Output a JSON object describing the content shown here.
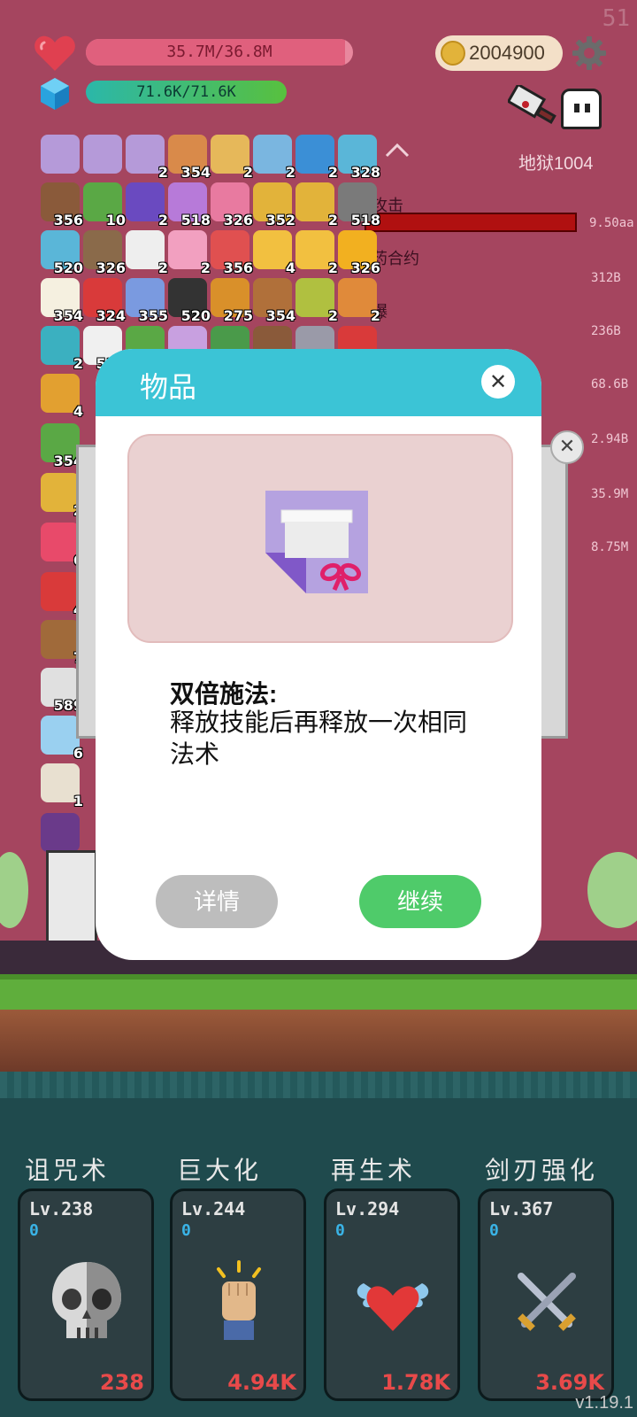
{
  "hud": {
    "fps": "51",
    "hp_text": "35.7M/36.8M",
    "hp_fraction": 0.97,
    "mp_text": "71.6K/71.6K",
    "mp_fraction": 1.0,
    "coins": "2004900",
    "level_name": "地狱1004"
  },
  "skills_list": [
    {
      "name": "攻击",
      "value": "9.50aa"
    },
    {
      "name": "药合约",
      "value": "312B"
    },
    {
      "name": "爆",
      "value": "236B"
    },
    {
      "name": "",
      "value": "68.6B"
    },
    {
      "name": "",
      "value": "2.94B"
    },
    {
      "name": "",
      "value": "35.9M"
    },
    {
      "name": "",
      "value": "8.75M"
    }
  ],
  "items": [
    {
      "icon": "box-icon",
      "count": "",
      "color": "#b59ad9"
    },
    {
      "icon": "box-icon",
      "count": "",
      "color": "#b59ad9"
    },
    {
      "icon": "box-icon",
      "count": "2",
      "color": "#b59ad9"
    },
    {
      "icon": "feather-icon",
      "count": "354",
      "color": "#d98a4a"
    },
    {
      "icon": "book-icon",
      "count": "2",
      "color": "#e6b85a"
    },
    {
      "icon": "molecule-icon",
      "count": "2",
      "color": "#7ab6e0"
    },
    {
      "icon": "star-card-icon",
      "count": "2",
      "color": "#3b8fd6"
    },
    {
      "icon": "pen-icon",
      "count": "328",
      "color": "#5ab6d8"
    },
    {
      "icon": "shield-icon",
      "count": "356",
      "color": "#8a5a3a"
    },
    {
      "icon": "card-icon",
      "count": "10",
      "color": "#5aa845"
    },
    {
      "icon": "wizard-hat-icon",
      "count": "2",
      "color": "#6a4ac0"
    },
    {
      "icon": "flower-icon",
      "count": "518",
      "color": "#b77ad9"
    },
    {
      "icon": "potion-icon",
      "count": "326",
      "color": "#e87aa0"
    },
    {
      "icon": "coins-icon",
      "count": "352",
      "color": "#e2b33a"
    },
    {
      "icon": "pineapple-icon",
      "count": "2",
      "color": "#e2b33a"
    },
    {
      "icon": "spike-ball-icon",
      "count": "518",
      "color": "#7a7a7a"
    },
    {
      "icon": "bird-icon",
      "count": "520",
      "color": "#5ab6d8"
    },
    {
      "icon": "coconut-icon",
      "count": "326",
      "color": "#8a6a4a"
    },
    {
      "icon": "spade-card-icon",
      "count": "2",
      "color": "#eeeeee"
    },
    {
      "icon": "sundae-icon",
      "count": "2",
      "color": "#f2a0c0"
    },
    {
      "icon": "boot-icon",
      "count": "356",
      "color": "#e05050"
    },
    {
      "icon": "sun-icon",
      "count": "4",
      "color": "#f2c040"
    },
    {
      "icon": "crown-icon",
      "count": "2",
      "color": "#f2c040"
    },
    {
      "icon": "sunflower-icon",
      "count": "326",
      "color": "#f2b020"
    },
    {
      "icon": "egg-icon",
      "count": "354",
      "color": "#f5f0e0"
    },
    {
      "icon": "red-card-icon",
      "count": "324",
      "color": "#d93a3a"
    },
    {
      "icon": "pill-icon",
      "count": "355",
      "color": "#7a9ae0"
    },
    {
      "icon": "pirate-flag-icon",
      "count": "520",
      "color": "#333333"
    },
    {
      "icon": "pie-icon",
      "count": "275",
      "color": "#d9902a"
    },
    {
      "icon": "spellbook-icon",
      "count": "354",
      "color": "#b0703a"
    },
    {
      "icon": "melon-icon",
      "count": "2",
      "color": "#b0c040"
    },
    {
      "icon": "briefcase-icon",
      "count": "2",
      "color": "#e08a3a"
    },
    {
      "icon": "target-icon",
      "count": "2",
      "color": "#3bb0c0"
    },
    {
      "icon": "flag-icon",
      "count": "512",
      "color": "#f0f0f0"
    },
    {
      "icon": "money-icon",
      "count": "",
      "color": "#5aa845"
    },
    {
      "icon": "unicorn-icon",
      "count": "",
      "color": "#c8a0e0"
    },
    {
      "icon": "turtle-icon",
      "count": "",
      "color": "#4a9a4a"
    },
    {
      "icon": "nut-icon",
      "count": "",
      "color": "#8a5a3a"
    },
    {
      "icon": "crossed-swords-icon",
      "count": "",
      "color": "#9a9aa8"
    },
    {
      "icon": "heart-icon",
      "count": "",
      "color": "#d93a3a"
    },
    {
      "icon": "scroll-icon",
      "count": "4",
      "color": "#e2a030"
    },
    {
      "icon": "watermelon-icon",
      "count": "354",
      "color": "#5aa845"
    },
    {
      "icon": "beer-icon",
      "count": "2",
      "color": "#e2b33a"
    },
    {
      "icon": "flame-icon",
      "count": "6",
      "color": "#e84a6a"
    },
    {
      "icon": "map-pin-icon",
      "count": "4",
      "color": "#d93a3a"
    },
    {
      "icon": "bow-icon",
      "count": "7",
      "color": "#a06a3a"
    },
    {
      "icon": "robot-icon",
      "count": "589",
      "color": "#e0e0e0"
    },
    {
      "icon": "ice-icon",
      "count": "6",
      "color": "#9ad0f0"
    },
    {
      "icon": "open-book-icon",
      "count": "1",
      "color": "#e8e0d0"
    },
    {
      "icon": "monster-icon",
      "count": "",
      "color": "#6a3a8a"
    }
  ],
  "bottom_skills": [
    {
      "title": "诅咒术",
      "level": "Lv.238",
      "zero": "0",
      "cost": "238",
      "icon": "skull-icon"
    },
    {
      "title": "巨大化",
      "level": "Lv.244",
      "zero": "0",
      "cost": "4.94K",
      "icon": "fist-icon"
    },
    {
      "title": "再生术",
      "level": "Lv.294",
      "zero": "0",
      "cost": "1.78K",
      "icon": "winged-heart-icon"
    },
    {
      "title": "剑刃强化",
      "level": "Lv.367",
      "zero": "0",
      "cost": "3.69K",
      "icon": "crossed-swords-icon"
    }
  ],
  "version": "v1.19.1",
  "modal": {
    "title": "物品",
    "close_symbol": "✕",
    "item_icon": "gift-box-icon",
    "desc_title": "双倍施法:",
    "desc_body": "释放技能后再释放一次相同法术",
    "detail_label": "详情",
    "continue_label": "继续",
    "back_close_symbol": "✕"
  },
  "colors": {
    "background": "#a5455f",
    "modal_header": "#3bc4d6",
    "continue": "#4fcb6a",
    "detail": "#bdbdbd",
    "cost": "#e84a4a"
  }
}
